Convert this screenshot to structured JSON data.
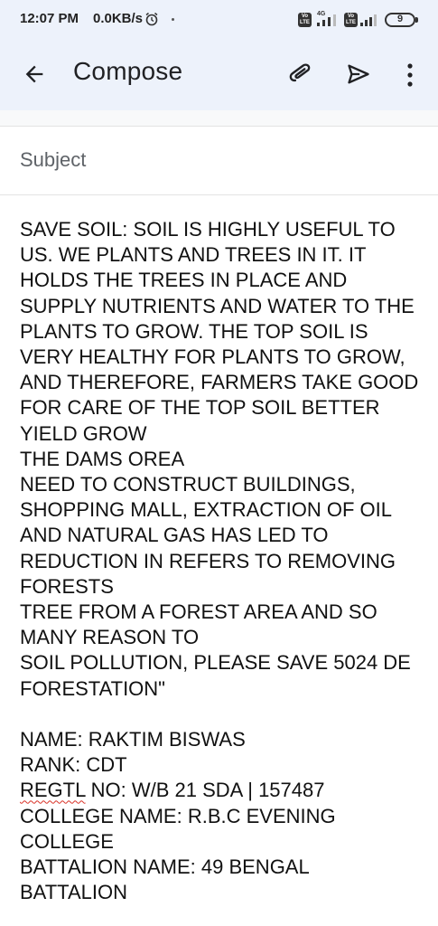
{
  "status_bar": {
    "time": "12:07 PM",
    "net_speed": "0.0KB/s",
    "network_type": "4G",
    "volte_label": "Vo LTE",
    "battery_level": "9",
    "icons": [
      "alarm-icon",
      "signal-icon",
      "battery-icon"
    ]
  },
  "app_bar": {
    "title": "Compose",
    "icons": [
      "back-arrow-icon",
      "attachment-icon",
      "send-icon",
      "more-vert-icon"
    ]
  },
  "compose": {
    "subject_placeholder": "Subject",
    "subject_value": "",
    "body": "SAVE SOIL:  SOIL IS HIGHLY USEFUL TO US. WE PLANTS AND TREES IN IT. IT HOLDS THE TREES IN PLACE AND SUPPLY NUTRIENTS AND WATER TO THE PLANTS TO GROW. THE TOP SOIL IS VERY HEALTHY FOR PLANTS TO GROW, AND THEREFORE, FARMERS TAKE GOOD FOR CARE OF THE TOP SOIL BETTER YIELD GROW\nTHE DAMS OREA\nNEED TO CONSTRUCT BUILDINGS, SHOPPING MALL, EXTRACTION OF OIL AND NATURAL GAS HAS LED TO REDUCTION IN REFERS TO REMOVING FORESTS\nTREE FROM A FOREST AREA AND SO MANY REASON TO\nSOIL POLLUTION, PLEASE SAVE 5024 DE FORESTATION\"",
    "signoff": {
      "name": "NAME: RAKTIM BISWAS",
      "rank": "RANK: CDT",
      "regtl_label": "REGTL",
      "regtl_rest": " NO: W/B 21 SDA | 157487",
      "college_line1": "COLLEGE NAME: R.B.C EVENING",
      "college_line2": "COLLEGE",
      "battalion_line1": "BATTALION NAME: 49 BENGAL",
      "battalion_line2": "BATTALION"
    }
  }
}
